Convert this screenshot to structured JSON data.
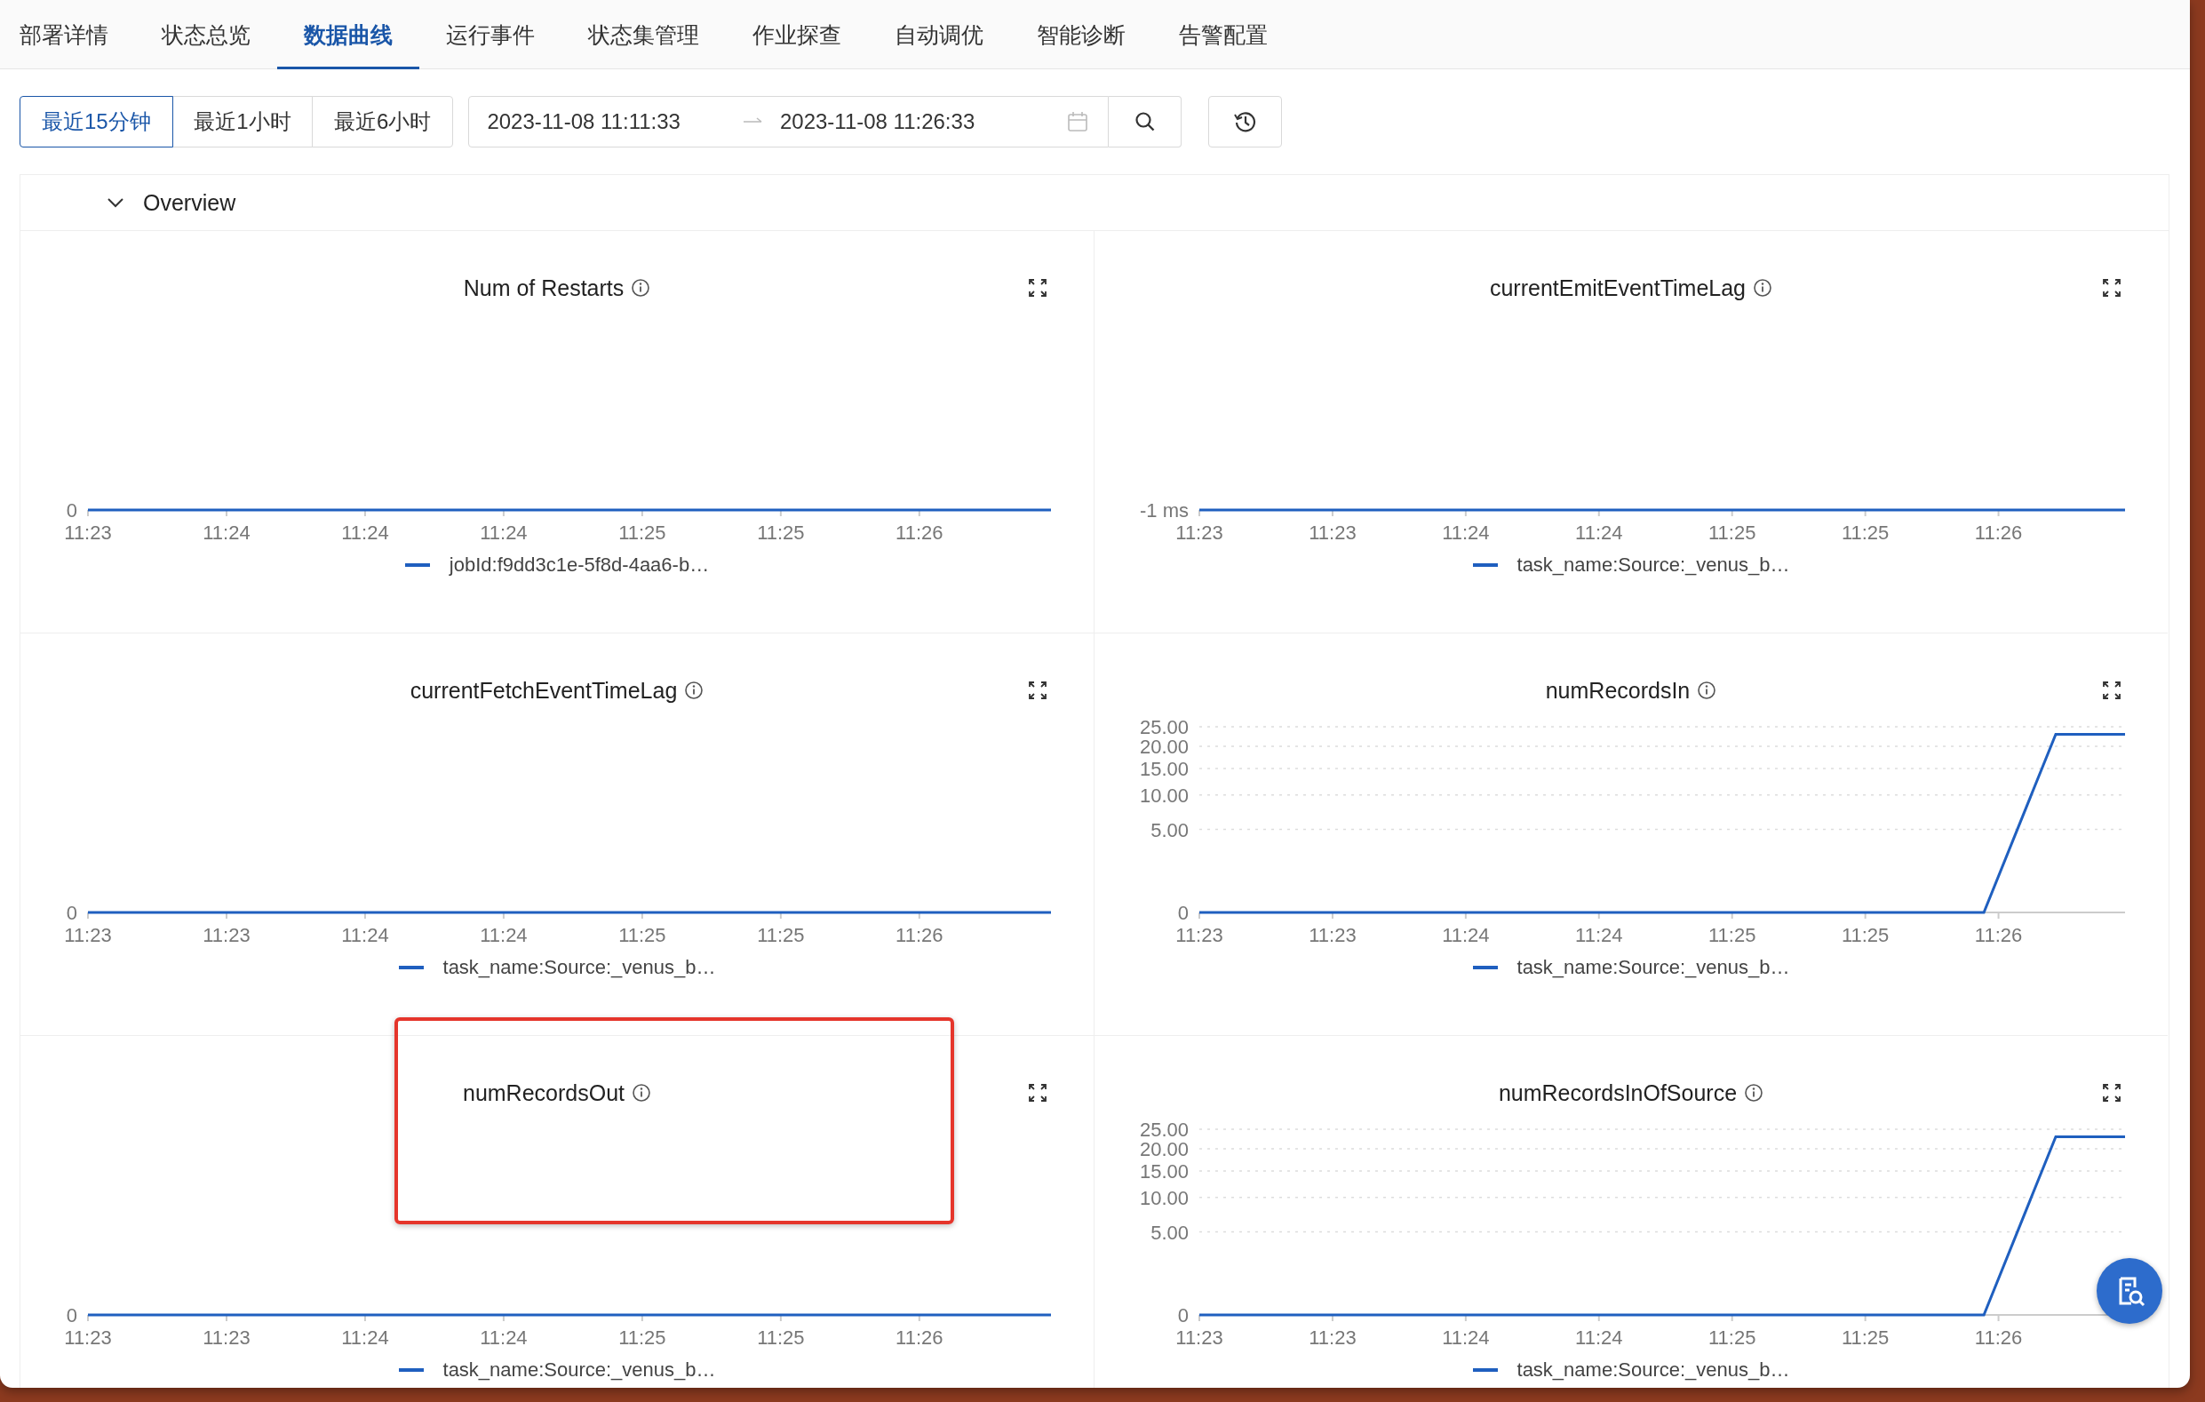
{
  "tabs": [
    {
      "label": "部署详情",
      "selected": false
    },
    {
      "label": "状态总览",
      "selected": false
    },
    {
      "label": "数据曲线",
      "selected": true
    },
    {
      "label": "运行事件",
      "selected": false
    },
    {
      "label": "状态集管理",
      "selected": false
    },
    {
      "label": "作业探查",
      "selected": false
    },
    {
      "label": "自动调优",
      "selected": false
    },
    {
      "label": "智能诊断",
      "selected": false
    },
    {
      "label": "告警配置",
      "selected": false
    }
  ],
  "quick_ranges": [
    {
      "label": "最近15分钟",
      "selected": true
    },
    {
      "label": "最近1小时",
      "selected": false
    },
    {
      "label": "最近6小时",
      "selected": false
    }
  ],
  "date_range": {
    "start": "2023-11-08 11:11:33",
    "end": "2023-11-08 11:26:33"
  },
  "section": {
    "title": "Overview",
    "expanded": true
  },
  "charts": [
    {
      "title": "Num of Restarts",
      "highlighted": false,
      "plot": {
        "kind": "flat",
        "y_labels": [
          "0"
        ],
        "x_labels": [
          "11:23",
          "11:24",
          "11:24",
          "11:24",
          "11:25",
          "11:25",
          "11:26"
        ],
        "legend": "jobId:f9dd3c1e-5f8d-4aa6-b…"
      }
    },
    {
      "title": "currentEmitEventTimeLag",
      "highlighted": false,
      "plot": {
        "kind": "flat",
        "y_labels": [
          "-1 ms"
        ],
        "x_labels": [
          "11:23",
          "11:23",
          "11:24",
          "11:24",
          "11:25",
          "11:25",
          "11:26"
        ],
        "legend": "task_name:Source:_venus_b…"
      }
    },
    {
      "title": "currentFetchEventTimeLag",
      "highlighted": false,
      "plot": {
        "kind": "flat",
        "y_labels": [
          "0"
        ],
        "x_labels": [
          "11:23",
          "11:23",
          "11:24",
          "11:24",
          "11:25",
          "11:25",
          "11:26"
        ],
        "legend": "task_name:Source:_venus_b…"
      }
    },
    {
      "title": "numRecordsIn",
      "highlighted": false,
      "plot": {
        "kind": "rise",
        "y_labels": [
          "25.00",
          "20.00",
          "15.00",
          "10.00",
          "5.00",
          "0"
        ],
        "x_labels": [
          "11:23",
          "11:23",
          "11:24",
          "11:24",
          "11:25",
          "11:25",
          "11:26"
        ],
        "legend": "task_name:Source:_venus_b…"
      }
    },
    {
      "title": "numRecordsOut",
      "highlighted": true,
      "plot": {
        "kind": "flat",
        "y_labels": [
          "0"
        ],
        "x_labels": [
          "11:23",
          "11:23",
          "11:24",
          "11:24",
          "11:25",
          "11:25",
          "11:26"
        ],
        "legend": "task_name:Source:_venus_b…"
      }
    },
    {
      "title": "numRecordsInOfSource",
      "highlighted": false,
      "plot": {
        "kind": "rise",
        "y_labels": [
          "25.00",
          "20.00",
          "15.00",
          "10.00",
          "5.00",
          "0"
        ],
        "x_labels": [
          "11:23",
          "11:23",
          "11:24",
          "11:24",
          "11:25",
          "11:25",
          "11:26"
        ],
        "legend": "task_name:Source:_venus_b…"
      }
    }
  ]
}
